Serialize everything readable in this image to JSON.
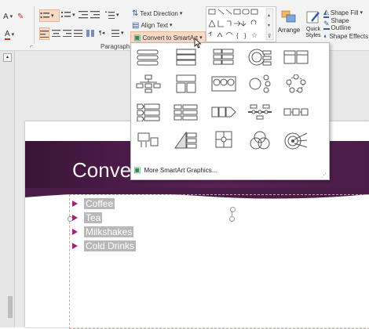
{
  "ribbon": {
    "paragraph_label": "Paragraph",
    "text_direction": "Text Direction",
    "align_text": "Align Text",
    "convert_smartart": "Convert to SmartArt",
    "arrange": "Arrange",
    "quick_styles": "Quick Styles",
    "shape_fill": "Shape Fill",
    "shape_outline": "Shape Outline",
    "shape_effects": "Shape Effects",
    "font_color_glyph": "A",
    "font_size_glyph": "A"
  },
  "dropdown": {
    "more_label": "More SmartArt Graphics..."
  },
  "slide": {
    "title": "Conver",
    "bullets": [
      "Coffee",
      "Tea",
      "Milkshakes",
      "Cold Drinks"
    ]
  },
  "colors": {
    "banner": "#4a1d47",
    "accent": "#a3246e",
    "highlight": "#f7d9c4"
  }
}
